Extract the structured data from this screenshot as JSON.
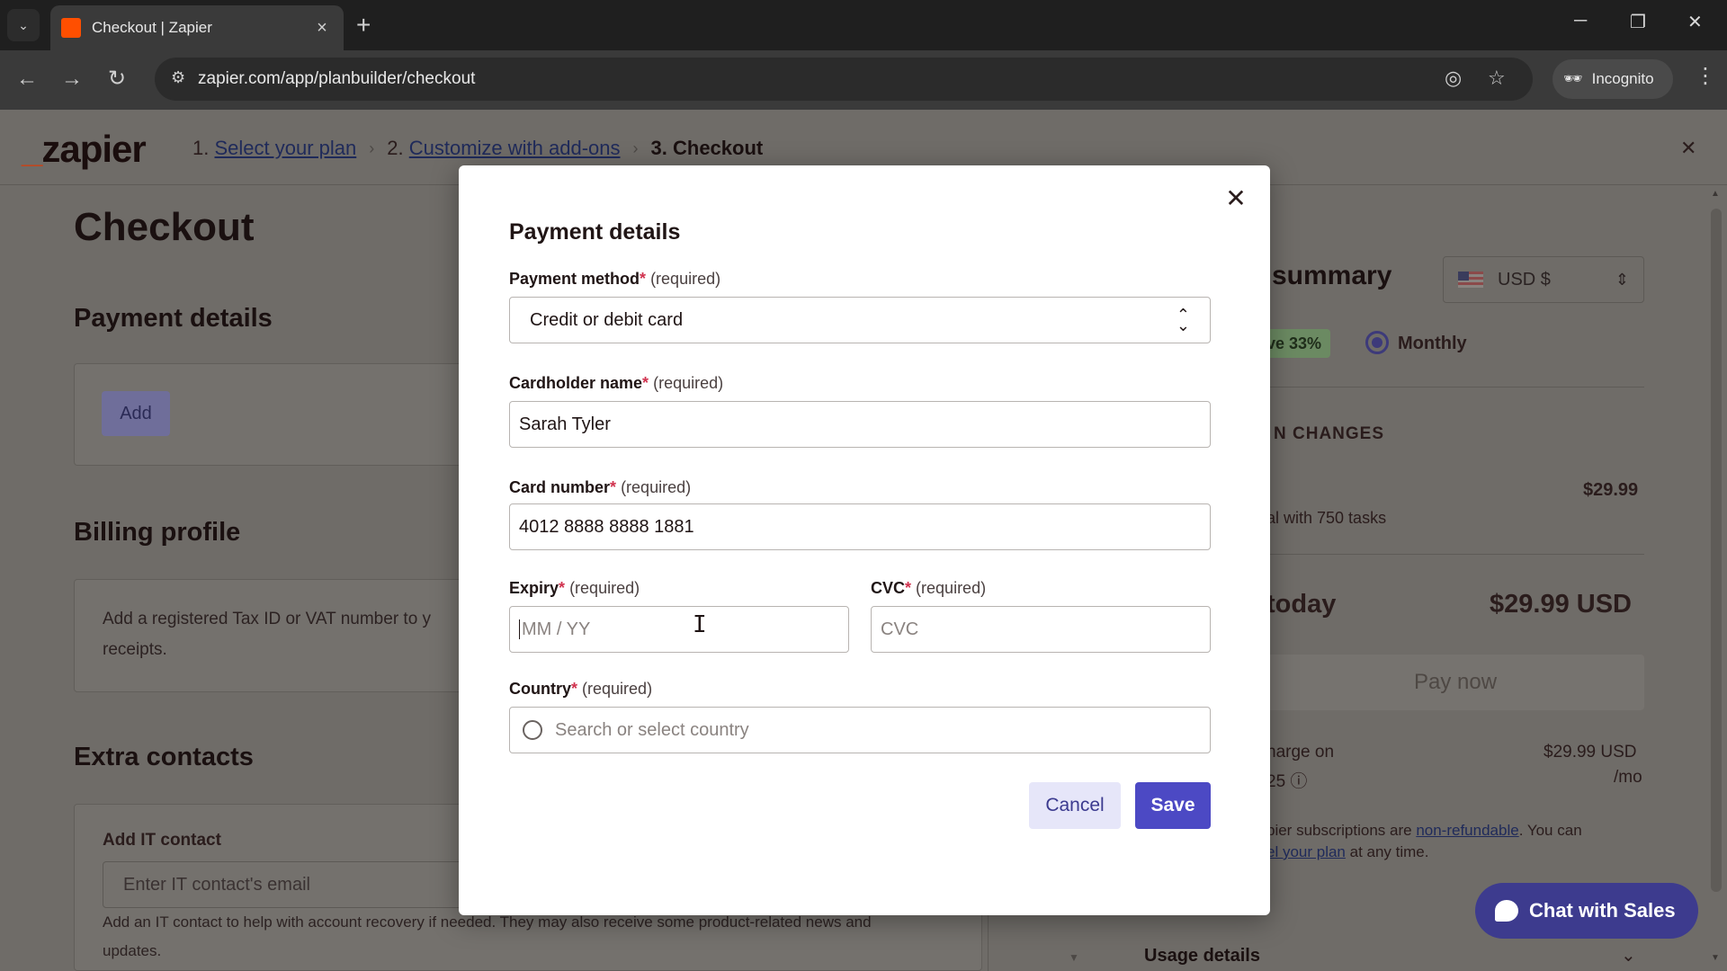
{
  "browser": {
    "tab_title": "Checkout | Zapier",
    "url": "zapier.com/app/planbuilder/checkout",
    "incognito_label": "Incognito"
  },
  "header": {
    "logo": "zapier",
    "steps": [
      {
        "num": "1.",
        "label": "Select your plan"
      },
      {
        "num": "2.",
        "label": "Customize with add-ons"
      },
      {
        "num": "3.",
        "label": "Checkout"
      }
    ]
  },
  "page": {
    "title": "Checkout",
    "payment_heading": "Payment details",
    "add_label": "Add",
    "billing_heading": "Billing profile",
    "billing_text_1": "Add a registered Tax ID or VAT number to y",
    "billing_text_2": "receipts.",
    "extra_heading": "Extra contacts",
    "it_label": "Add IT contact",
    "it_placeholder": "Enter IT contact's email",
    "it_help_1": "Add an IT contact to help with account recovery if needed. They may also receive some product-related news and",
    "it_help_2": "updates."
  },
  "summary": {
    "title": "summary",
    "currency": "USD $",
    "save_badge": "ve 33%",
    "billing_option": "Monthly",
    "changes_heading": "N CHANGES",
    "plan_price": "$29.99",
    "plan_desc": "al with 750 tasks",
    "today_label": "today",
    "today_amount": "$29.99 USD",
    "pay_now": "Pay now",
    "next_charge_1": "harge on",
    "next_charge_2": "25",
    "next_amount": "$29.99 USD",
    "next_per": "/mo",
    "refund_1": "pier subscriptions are ",
    "refund_link": "non-refundable",
    "refund_2": ". You can",
    "refund_3_link": "el your plan",
    "refund_3": " at any time.",
    "usage": "Usage details"
  },
  "chat": {
    "label": "Chat with Sales"
  },
  "modal": {
    "title": "Payment details",
    "required": "(required)",
    "payment_method_label": "Payment method",
    "payment_method_value": "Credit or debit card",
    "cardholder_label": "Cardholder name",
    "cardholder_value": "Sarah Tyler",
    "card_number_label": "Card number",
    "card_number_value": "4012 8888 8888 1881",
    "expiry_label": "Expiry",
    "expiry_placeholder": "MM / YY",
    "cvc_label": "CVC",
    "cvc_placeholder": "CVC",
    "country_label": "Country",
    "country_placeholder": "Search or select country",
    "cancel": "Cancel",
    "save": "Save"
  }
}
